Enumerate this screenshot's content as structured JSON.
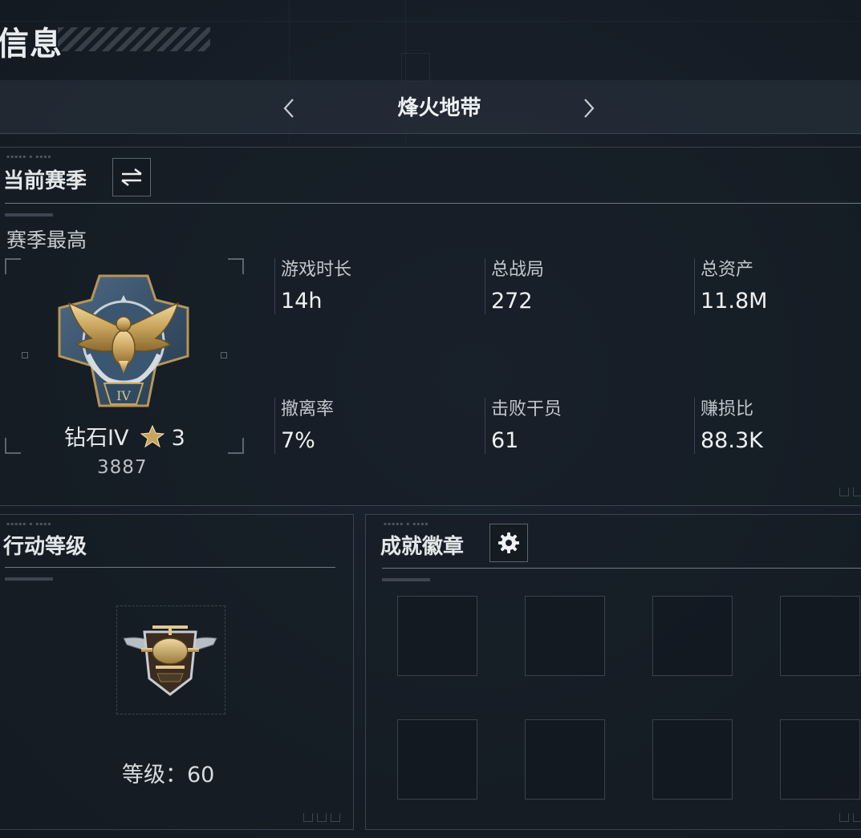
{
  "page": {
    "title": "信息"
  },
  "mode_selector": {
    "title": "烽火地带"
  },
  "season": {
    "title": "当前赛季",
    "best_label": "赛季最高",
    "rank_name": "钻石IV",
    "rank_stars": "3",
    "rank_score": "3887",
    "stats": [
      {
        "label": "游戏时长",
        "value": "14h"
      },
      {
        "label": "总战局",
        "value": "272"
      },
      {
        "label": "总资产",
        "value": "11.8M"
      },
      {
        "label": "撤离率",
        "value": "7%"
      },
      {
        "label": "击败干员",
        "value": "61"
      },
      {
        "label": "赚损比",
        "value": "88.3K"
      }
    ]
  },
  "action_level": {
    "title": "行动等级",
    "level_label": "等级：",
    "level_value": "60"
  },
  "achievements": {
    "title": "成就徽章",
    "slot_count": 8
  },
  "colors": {
    "background": "#161d26",
    "panel_border": "#39434d",
    "text_primary": "#e9ecef",
    "gold": "#c9a45c"
  }
}
